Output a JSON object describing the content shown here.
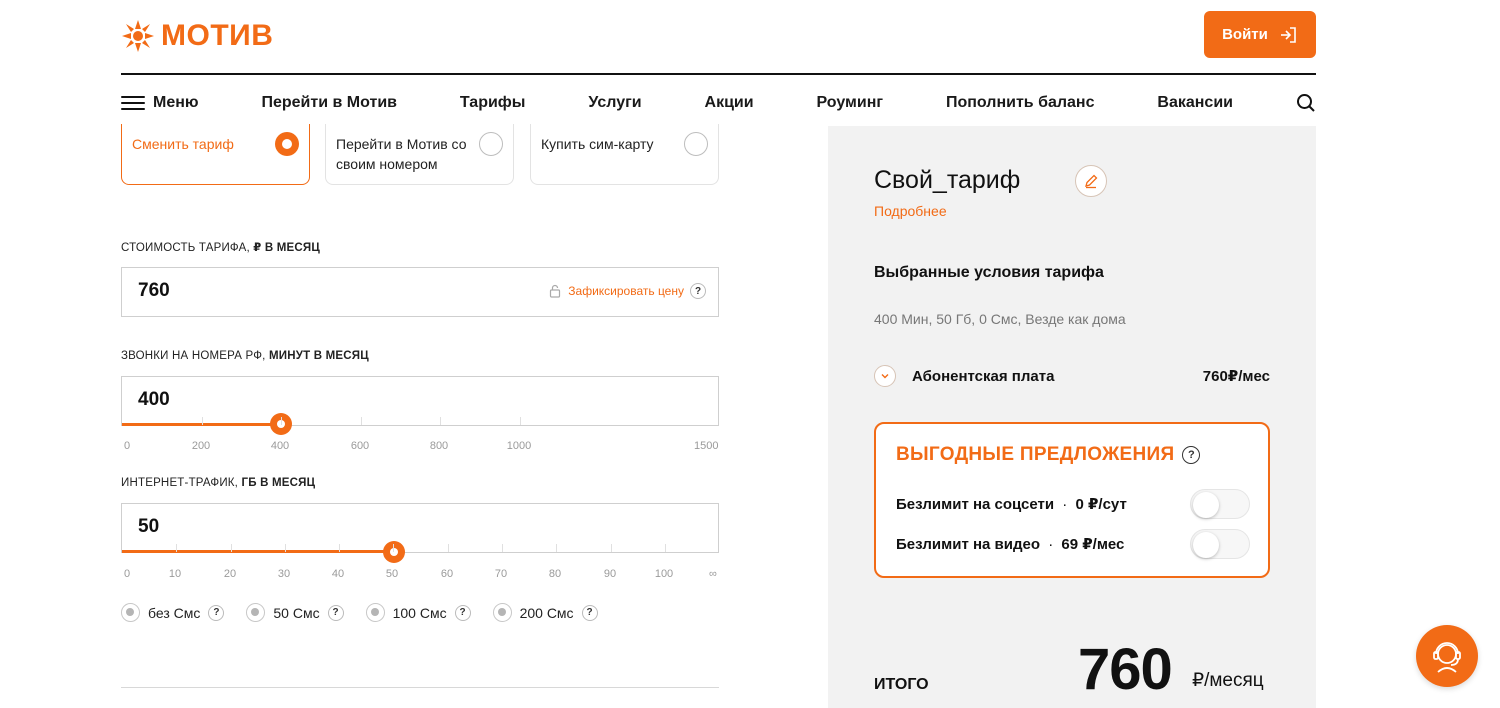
{
  "brand": {
    "name": "МОТИВ",
    "accent": "#f26b16"
  },
  "header": {
    "login_label": "Войти"
  },
  "nav": {
    "menu_label": "Меню",
    "items": [
      "Перейти в Мотив",
      "Тарифы",
      "Услуги",
      "Акции",
      "Роуминг",
      "Пополнить баланс",
      "Вакансии"
    ]
  },
  "options": [
    {
      "label": "Сменить тариф",
      "selected": true
    },
    {
      "label": "Перейти в Мотив со своим номером",
      "selected": false
    },
    {
      "label": "Купить сим-карту",
      "selected": false
    }
  ],
  "cost": {
    "label_light": "Стоимость тарифа,",
    "label_bold": "₽ в месяц",
    "value": "760",
    "fix_price": "Зафиксировать цену",
    "help": "?"
  },
  "calls": {
    "label_light": "Звонки на номера РФ,",
    "label_bold": "минут в месяц",
    "value": "400",
    "level_fraction": 0.2667,
    "scale": [
      "0",
      "200",
      "400",
      "600",
      "800",
      "1000",
      "1500"
    ]
  },
  "internet": {
    "label_light": "Интернет-трафик,",
    "label_bold": "ГБ в месяц",
    "value": "50",
    "level_fraction": 0.4545,
    "scale": [
      "0",
      "10",
      "20",
      "30",
      "40",
      "50",
      "60",
      "70",
      "80",
      "90",
      "100",
      "∞"
    ]
  },
  "sms": [
    {
      "label": "без Смс",
      "help": "?"
    },
    {
      "label": "50 Смс",
      "help": "?"
    },
    {
      "label": "100 Смс",
      "help": "?"
    },
    {
      "label": "200 Смс",
      "help": "?"
    }
  ],
  "summary": {
    "title": "Свой_тариф",
    "more": "Подробнее",
    "conditions_heading": "Выбранные условия тарифа",
    "conditions": "400 Мин, 50 Гб, 0 Смс, Везде как дома",
    "fee_label": "Абонентская плата",
    "fee_value": "760₽/мес",
    "offers_title": "Выгодные предложения",
    "offers_help": "?",
    "offers": [
      {
        "name": "Безлимит на соцсети",
        "sep": "·",
        "price": "0 ₽/сут",
        "enabled": false
      },
      {
        "name": "Безлимит на видео",
        "sep": "·",
        "price": "69 ₽/мес",
        "enabled": false
      }
    ],
    "total_label": "итого",
    "total_value": "760",
    "total_unit": "₽/месяц"
  }
}
